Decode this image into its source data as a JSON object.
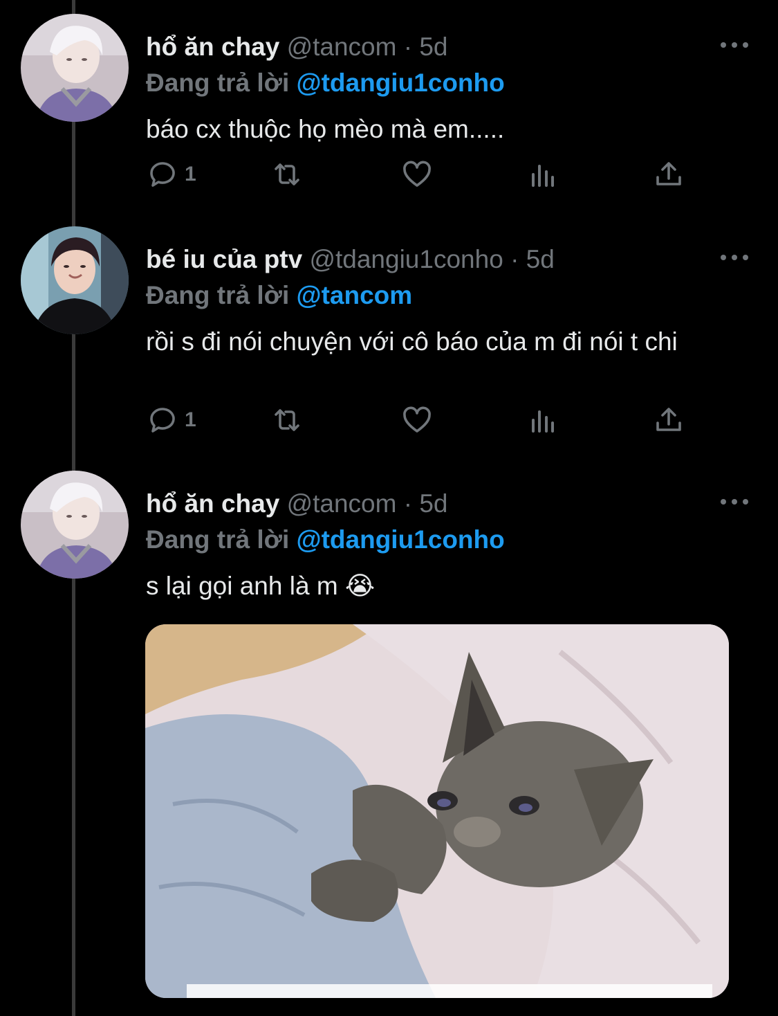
{
  "tweets": [
    {
      "display_name": "hổ ăn chay",
      "handle": "@tancom",
      "separator": "·",
      "time": "5d",
      "reply_prefix": "Đang trả lời",
      "reply_to": "@tdangiu1conho",
      "text": "báo cx thuộc họ mèo mà em.....",
      "reply_count": "1",
      "avatar_icon": "avatar-white-hair"
    },
    {
      "display_name": "bé iu của ptv",
      "handle": "@tdangiu1conho",
      "separator": "·",
      "time": "5d",
      "reply_prefix": "Đang trả lời",
      "reply_to": "@tancom",
      "text": "rồi s đi nói chuyện với cô báo của m đi nói t chi",
      "reply_count": "1",
      "avatar_icon": "avatar-dark-hair"
    },
    {
      "display_name": "hổ ăn chay",
      "handle": "@tancom",
      "separator": "·",
      "time": "5d",
      "reply_prefix": "Đang trả lời",
      "reply_to": "@tdangiu1conho",
      "text": "s lại gọi anh là m 😭",
      "avatar_icon": "avatar-white-hair",
      "media_icon": "crying-cat-image"
    }
  ],
  "colors": {
    "background": "#000000",
    "text": "#e7e9ea",
    "muted": "#71767b",
    "link": "#1d9bf0",
    "thread_line": "#3a3a3a"
  }
}
